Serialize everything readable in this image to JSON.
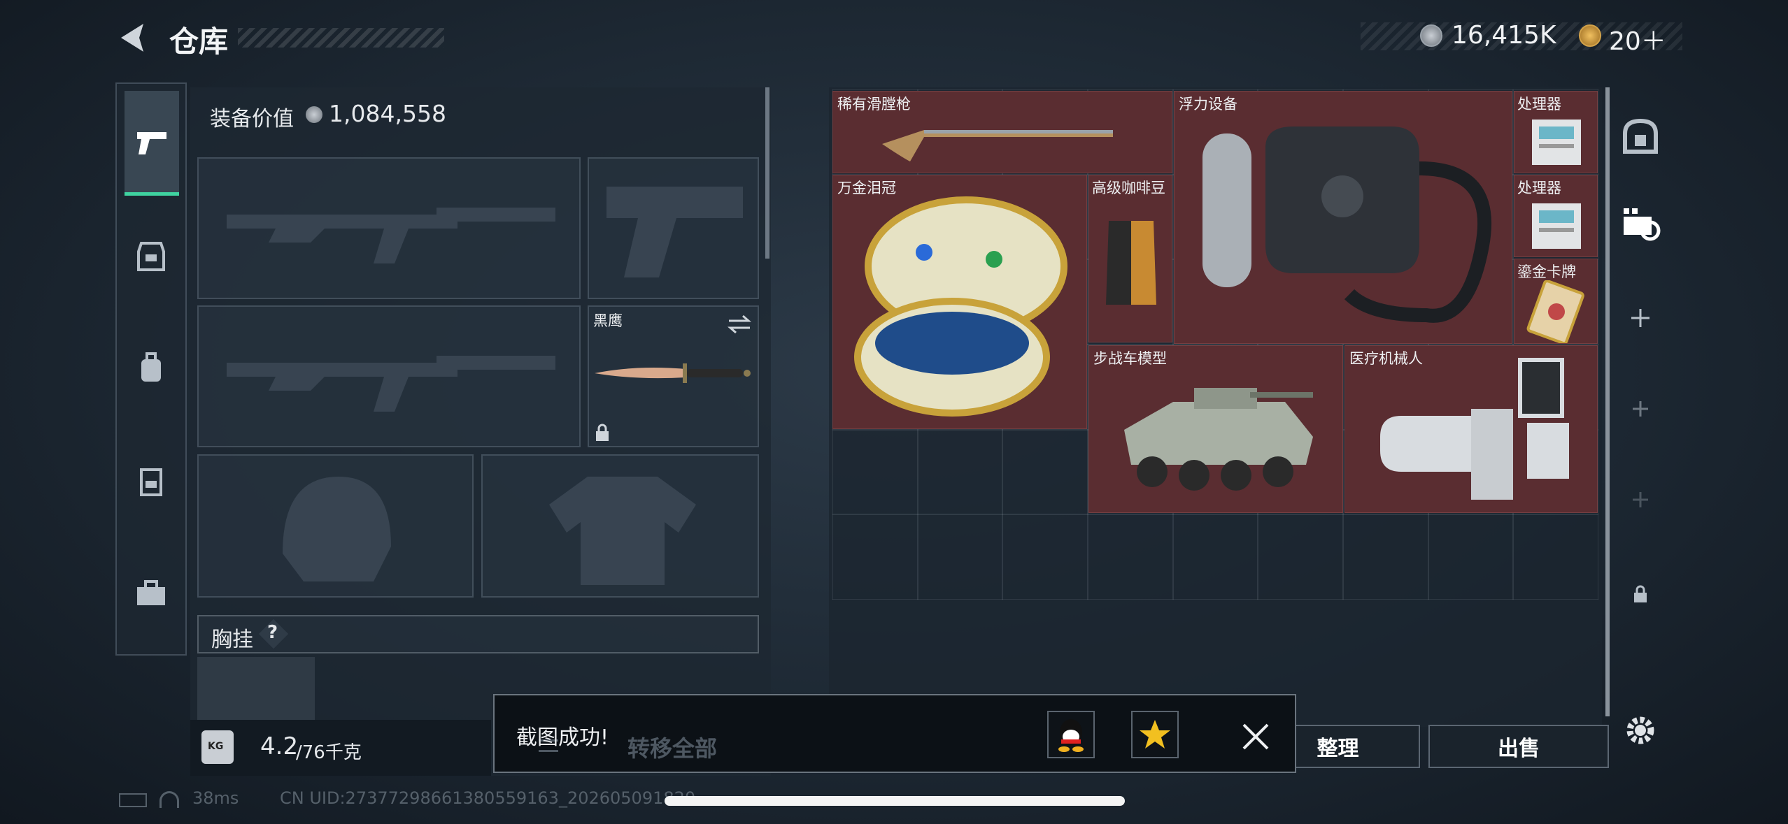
{
  "header": {
    "title": "仓库",
    "currency_value": "16,415K",
    "token_value": "20＋"
  },
  "sidebar": {
    "items": [
      {
        "name": "weapon"
      },
      {
        "name": "armor"
      },
      {
        "name": "backpack"
      },
      {
        "name": "chest-rig"
      },
      {
        "name": "toolbox"
      }
    ]
  },
  "loadout": {
    "equip_value_label": "装备价值",
    "equip_value": "1,084,558",
    "melee_label": "黑鹰",
    "chest_rig_label": "胸挂",
    "chest_rig_help": "?",
    "weight_value": "4.2",
    "weight_max": "/76千克",
    "weight_badge": "KG"
  },
  "stash": {
    "items": [
      {
        "label": "稀有滑膛枪",
        "color": "#5a2d31"
      },
      {
        "label": "浮力设备"
      },
      {
        "label": "处理器"
      },
      {
        "label": "处理器"
      },
      {
        "label": "万金泪冠"
      },
      {
        "label": "高级咖啡豆"
      },
      {
        "label": "鎏金卡牌"
      },
      {
        "label": "步战车模型"
      },
      {
        "label": "医疗机械人"
      }
    ]
  },
  "actions": {
    "transfer_all": "转移全部",
    "sort": "整理",
    "sell": "出售"
  },
  "toast": {
    "message": "截图成功!"
  },
  "status": {
    "ping": "38ms",
    "uid": "CN UID:27377298661380559163_202605091820"
  },
  "colors": {
    "item_bg": "#5a2d31",
    "accent": "#3fd3a0"
  }
}
